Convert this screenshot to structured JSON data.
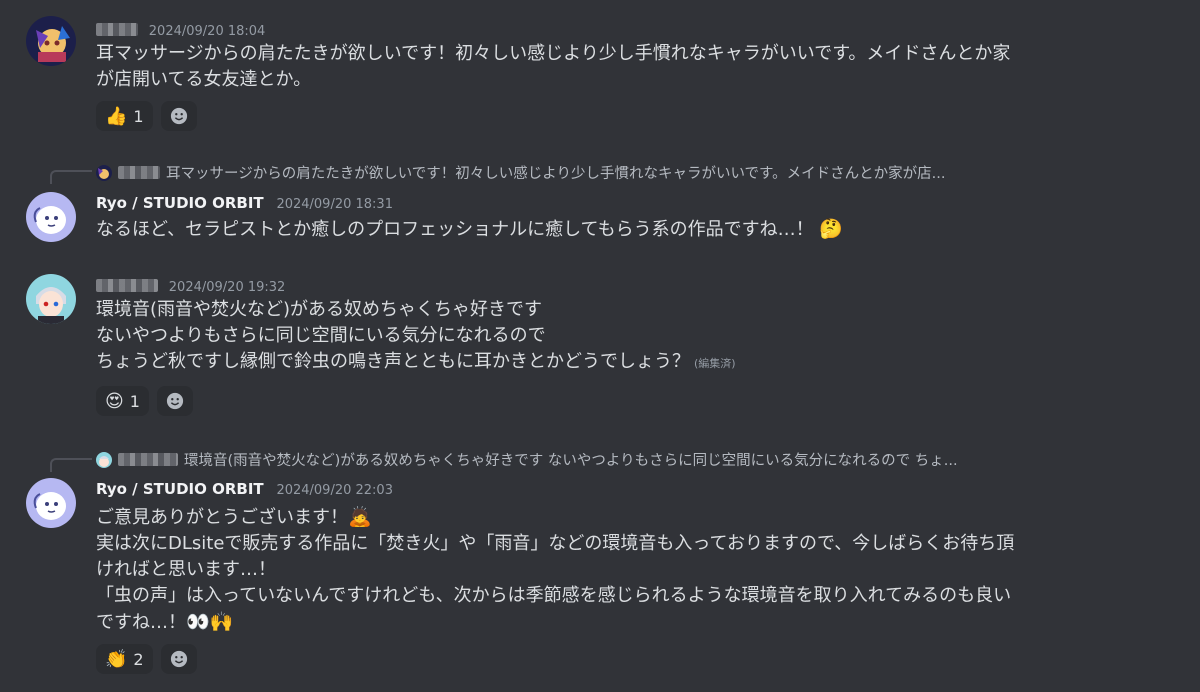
{
  "messages": [
    {
      "timestamp": "2024/09/20 18:04",
      "lines": [
        "耳マッサージからの肩たたきが欲しいです！初々しい感じより少し手慣れなキャラがいいです。メイドさんとか家",
        "が店開いてる女友達とか。"
      ],
      "reactions": [
        {
          "emoji": "👍",
          "count": "1"
        }
      ]
    },
    {
      "reply_preview": "耳マッサージからの肩たたきが欲しいです！初々しい感じより少し手慣れなキャラがいいです。メイドさんとか家が店...",
      "username": "Ryo / STUDIO ORBIT",
      "timestamp": "2024/09/20 18:31",
      "lines": [
        "なるほど、セラピストとか癒しのプロフェッショナルに癒してもらう系の作品ですね…！"
      ],
      "inline_emoji": "🤔"
    },
    {
      "timestamp": "2024/09/20 19:32",
      "lines": [
        "環境音(雨音や焚火など)がある奴めちゃくちゃ好きです",
        "ないやつよりもさらに同じ空間にいる気分になれるので",
        "ちょうど秋ですし縁側で鈴虫の鳴き声とともに耳かきとかどうでしょう？"
      ],
      "edited_label": "(編集済)",
      "reactions": [
        {
          "emoji": "😍",
          "count": "1"
        }
      ]
    },
    {
      "reply_preview": "環境音(雨音や焚火など)がある奴めちゃくちゃ好きです ないやつよりもさらに同じ空間にいる気分になれるので ちょ...",
      "username": "Ryo / STUDIO ORBIT",
      "timestamp": "2024/09/20 22:03",
      "lines": [
        "ご意見ありがとうございます！",
        "実は次にDLsiteで販売する作品に「焚き火」や「雨音」などの環境音も入っておりますので、今しばらくお待ち頂",
        "ければと思います…！",
        "「虫の声」は入っていないんですけれども、次からは季節感を感じられるような環境音を取り入れてみるのも良い",
        "ですね…！"
      ],
      "line1_emoji": "🙇",
      "last_emojis": "👀🙌",
      "reactions": [
        {
          "emoji": "👏",
          "count": "2"
        }
      ]
    }
  ],
  "add_reaction_icon": "smiley-face-icon",
  "colors": {
    "background": "#313338",
    "reaction_bg": "#2b2d31",
    "username": "#f2f3f5",
    "timestamp": "#949ba4"
  }
}
